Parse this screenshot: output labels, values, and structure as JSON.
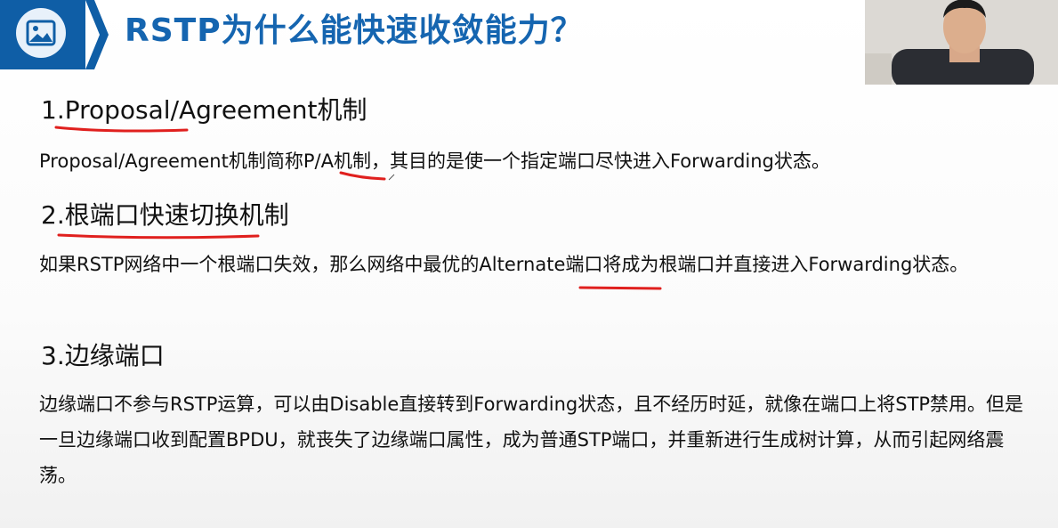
{
  "header": {
    "title": "RSTP为什么能快速收敛能力？"
  },
  "icons": {
    "header_icon": "image-icon",
    "header_arrow": "chevron-right-icon"
  },
  "colors": {
    "brand_blue": "#1565b0",
    "header_box": "#0f5ea6",
    "annotation_red": "#e0201e"
  },
  "sections": [
    {
      "heading": "1.Proposal/Agreement机制",
      "text": "Proposal/Agreement机制简称P/A机制，其目的是使一个指定端口尽快进入Forwarding状态。"
    },
    {
      "heading": "2.根端口快速切换机制",
      "text": "如果RSTP网络中一个根端口失效，那么网络中最优的Alternate端口将成为根端口并直接进入Forwarding状态。"
    },
    {
      "heading": "3.边缘端口",
      "text": "边缘端口不参与RSTP运算，可以由Disable直接转到Forwarding状态，且不经历时延，就像在端口上将STP禁用。但是一旦边缘端口收到配置BPDU，就丧失了边缘端口属性，成为普通STP端口，并重新进行生成树计算，从而引起网络震荡。"
    }
  ]
}
